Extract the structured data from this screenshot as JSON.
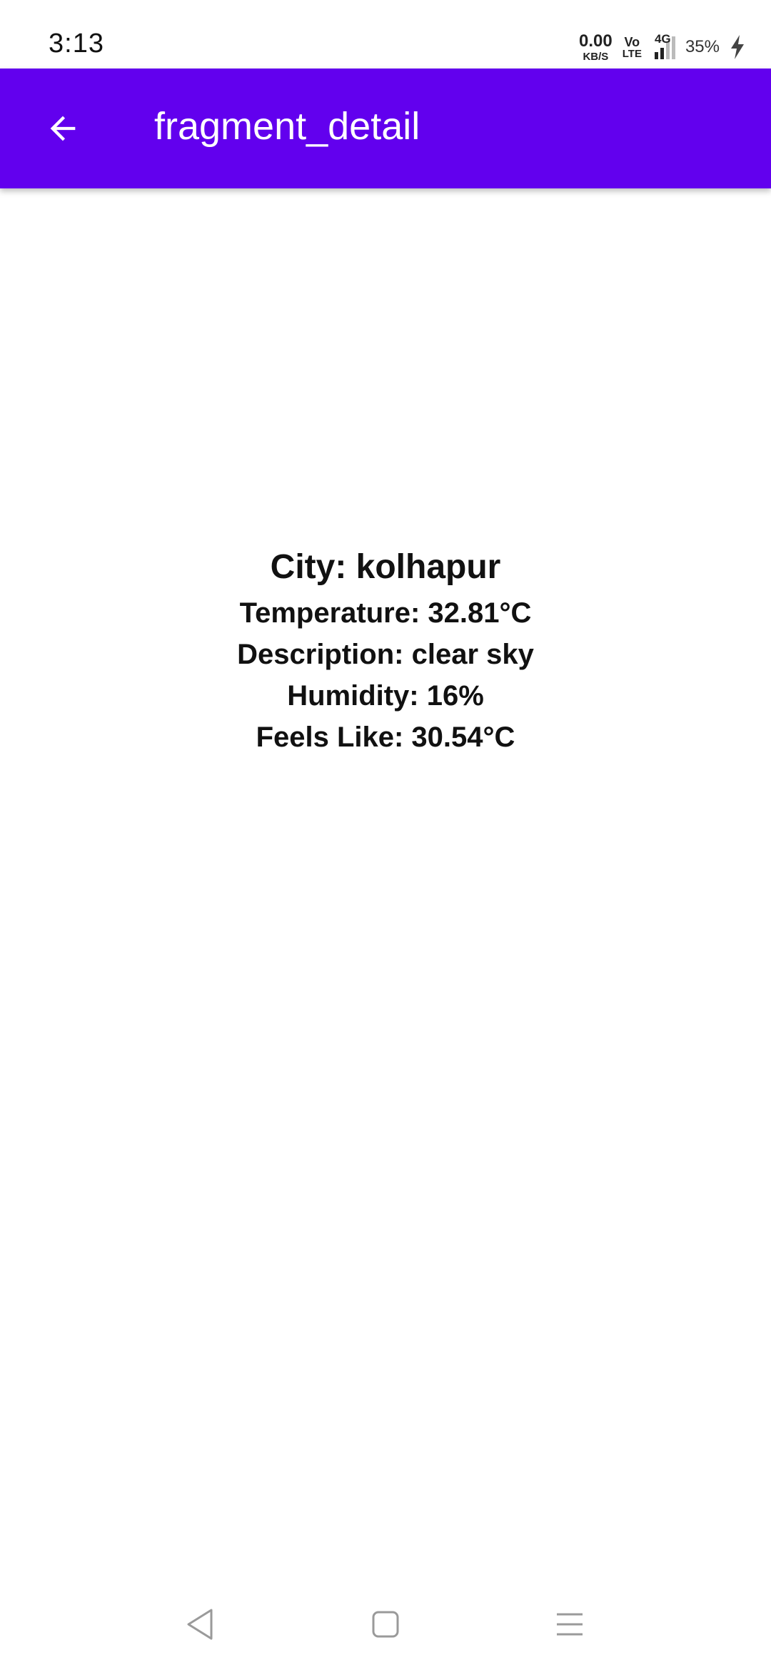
{
  "status_bar": {
    "time": "3:13",
    "net_speed_value": "0.00",
    "net_speed_unit": "KB/S",
    "volte_top": "Vo",
    "volte_bottom": "LTE",
    "network_type": "4G",
    "battery": "35%",
    "icons": [
      "volte-icon",
      "signal-icon",
      "charging-bolt-icon"
    ]
  },
  "app_bar": {
    "title": "fragment_detail",
    "background_color": "#6200EE",
    "back_icon": "arrow-left-icon"
  },
  "weather": {
    "city": "City: kolhapur",
    "temperature": "Temperature: 32.81°C",
    "description": "Description: clear sky",
    "humidity": "Humidity: 16%",
    "feels_like": "Feels Like: 30.54°C"
  },
  "nav_bar": {
    "icons": [
      "nav-back-icon",
      "nav-home-icon",
      "nav-recents-icon"
    ]
  }
}
